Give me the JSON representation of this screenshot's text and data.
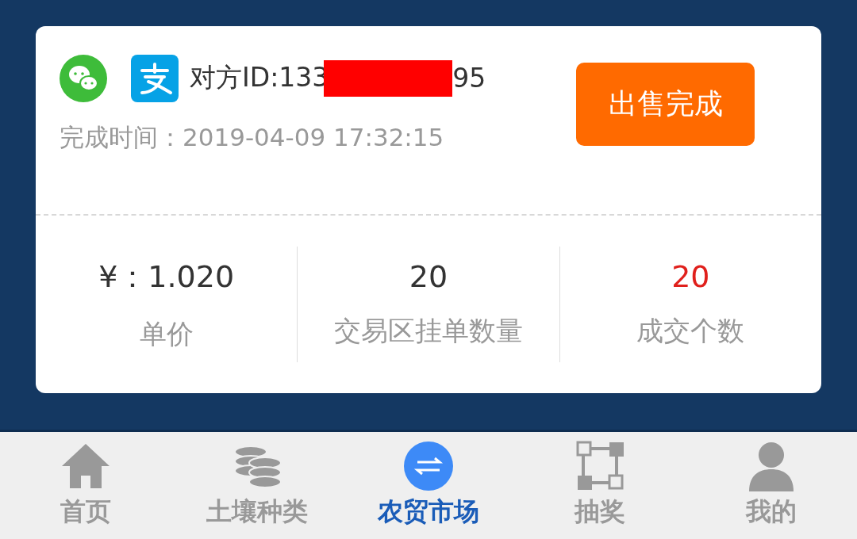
{
  "order": {
    "payment_methods": [
      {
        "kind": "wechat"
      },
      {
        "kind": "alipay"
      }
    ],
    "id_label": "对方ID:133",
    "id_suffix": "95",
    "redacted": true,
    "time_label": "完成时间：",
    "time": "2019-04-09 17:32:15",
    "status_button": "出售完成"
  },
  "stats": [
    {
      "value": "¥：1.020",
      "label": "单价",
      "color": "#333333"
    },
    {
      "value": "20",
      "label": "交易区挂单数量",
      "color": "#333333"
    },
    {
      "value": "20",
      "label": "成交个数",
      "color": "#e0201c"
    }
  ],
  "nav": [
    {
      "kind": "home",
      "label": "首页",
      "selected": false
    },
    {
      "kind": "coins",
      "label": "土壤种类",
      "selected": false
    },
    {
      "kind": "exchange",
      "label": "农贸市场",
      "selected": true
    },
    {
      "kind": "lottery",
      "label": "抽奖",
      "selected": false
    },
    {
      "kind": "user",
      "label": "我的",
      "selected": false
    }
  ]
}
